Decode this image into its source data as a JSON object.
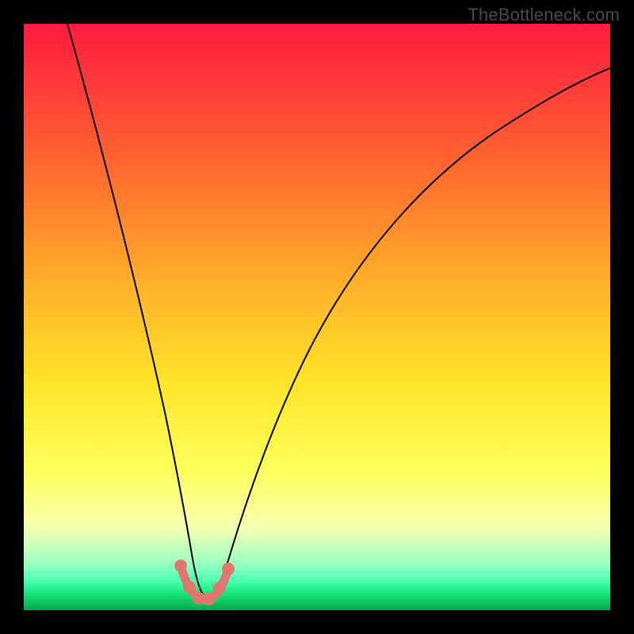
{
  "attribution": "TheBottleneck.com",
  "colors": {
    "frame": "#000000",
    "attribution_text": "#4b4b4b",
    "curve": "#000000",
    "marker": "#e0776e",
    "gradient_stops": [
      "#ff1a3e",
      "#ff3a3a",
      "#ff6a2e",
      "#ffb229",
      "#ffe62a",
      "#feff5a",
      "#f5ffb0",
      "#9affc0",
      "#4bffb0",
      "#18e880",
      "#0bbf5a",
      "#0aa54e"
    ]
  },
  "chart_data": {
    "type": "line",
    "title": "",
    "xlabel": "",
    "ylabel": "",
    "xlim": [
      0,
      100
    ],
    "ylim": [
      0,
      100
    ],
    "grid": false,
    "legend": false,
    "x": [
      0,
      5,
      10,
      15,
      20,
      22,
      24,
      26,
      27,
      28,
      29,
      30,
      31,
      32,
      33,
      35,
      38,
      42,
      48,
      55,
      62,
      70,
      80,
      90,
      100
    ],
    "series": [
      {
        "name": "bottleneck-curve",
        "values": [
          100,
          81,
          63,
          45,
          27,
          21,
          14,
          8,
          5,
          3,
          2,
          2,
          2,
          3,
          6,
          11,
          21,
          33,
          48,
          61,
          70,
          77,
          84,
          89,
          92
        ]
      }
    ],
    "markers": {
      "name": "highlight-range",
      "points": [
        {
          "x": 26,
          "y": 8
        },
        {
          "x": 27.5,
          "y": 4.5
        },
        {
          "x": 29,
          "y": 2.5
        },
        {
          "x": 30.5,
          "y": 2
        },
        {
          "x": 32,
          "y": 3
        },
        {
          "x": 33.5,
          "y": 6
        }
      ]
    },
    "note": "Values are read from pixel positions; x is approximate horizontal percentage across the plot, y is approximate vertical percentage from bottom (0) to top (100). Minimum of the curve sits near x≈30."
  }
}
